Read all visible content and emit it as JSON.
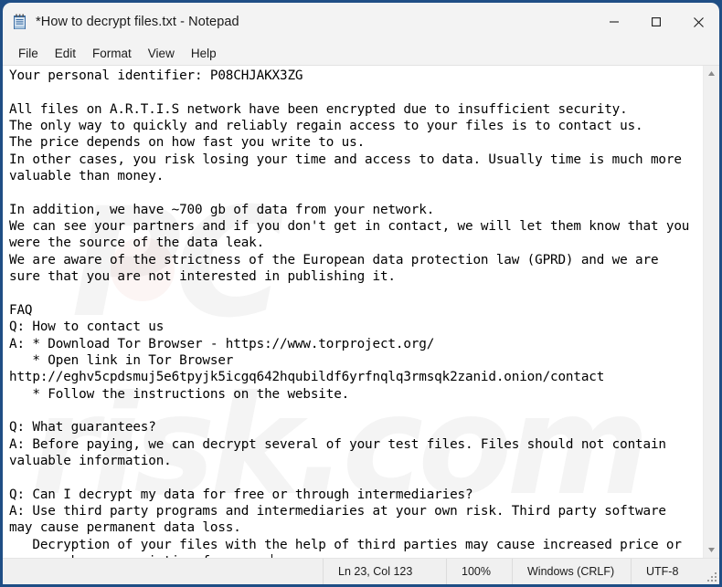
{
  "window": {
    "title": "*How to decrypt files.txt - Notepad",
    "icon": "notepad-icon",
    "border_color": "#1f4e85",
    "controls": [
      {
        "name": "minimize-button",
        "glyph": "—"
      },
      {
        "name": "maximize-button",
        "glyph": "☐"
      },
      {
        "name": "close-button",
        "glyph": "✕"
      }
    ]
  },
  "menu": {
    "items": [
      {
        "label": "File"
      },
      {
        "label": "Edit"
      },
      {
        "label": "Format"
      },
      {
        "label": "View"
      },
      {
        "label": "Help"
      }
    ]
  },
  "document": {
    "personal_identifier": "P08CHJAKX3ZG",
    "tor_browser_url": "https://www.torproject.org/",
    "onion_contact_url": "http://eghv5cpdsmuj5e6tpyjk5icgq642hqubildf6yrfnqlq3rmsqk2zanid.onion/contact",
    "data_volume": "~700 gb",
    "network_name": "A.R.T.I.S",
    "law_reference": "GPRD",
    "body": "Your personal identifier: P08CHJAKX3ZG\n\nAll files on A.R.T.I.S network have been encrypted due to insufficient security.\nThe only way to quickly and reliably regain access to your files is to contact us.\nThe price depends on how fast you write to us.\nIn other cases, you risk losing your time and access to data. Usually time is much more\nvaluable than money.\n\nIn addition, we have ~700 gb of data from your network.\nWe can see your partners and if you don't get in contact, we will let them know that you\nwere the source of the data leak.\nWe are aware of the strictness of the European data protection law (GPRD) and we are\nsure that you are not interested in publishing it.\n\nFAQ\nQ: How to contact us\nA: * Download Tor Browser - https://www.torproject.org/\n   * Open link in Tor Browser\nhttp://eghv5cpdsmuj5e6tpyjk5icgq642hqubildf6yrfnqlq3rmsqk2zanid.onion/contact\n   * Follow the instructions on the website.\n\nQ: What guarantees?\nA: Before paying, we can decrypt several of your test files. Files should not contain\nvaluable information.\n\nQ: Can I decrypt my data for free or through intermediaries?\nA: Use third party programs and intermediaries at your own risk. Third party software\nmay cause permanent data loss.\n   Decryption of your files with the help of third parties may cause increased price or\nyou can become a victim of a scam."
  },
  "watermark": {
    "line1": "PC",
    "line2": "risk.com"
  },
  "scrollbar": {
    "up_glyph": "▲",
    "down_glyph": "▼"
  },
  "statusbar": {
    "cursor_position": "Ln 23, Col 123",
    "zoom_level": "100%",
    "line_ending": "Windows (CRLF)",
    "encoding": "UTF-8"
  }
}
